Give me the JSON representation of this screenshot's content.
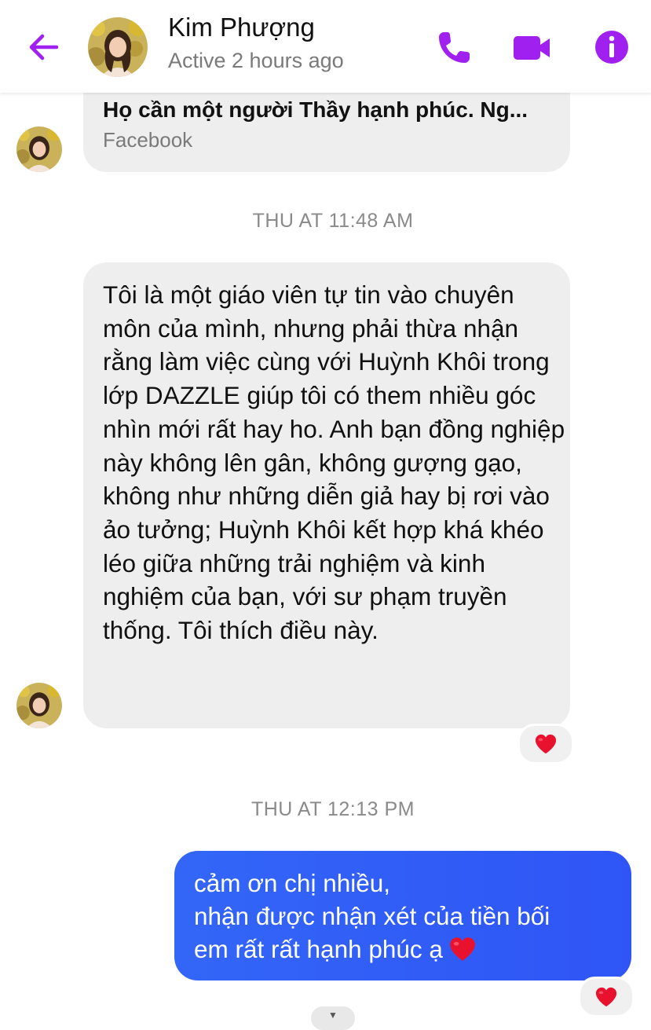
{
  "header": {
    "contact_name": "Kim Phượng",
    "status": "Active 2 hours ago",
    "accent_color": "#a020f0"
  },
  "messages": {
    "link_preview": {
      "title": "Họ cần một người Thầy hạnh phúc. Ng...",
      "source": "Facebook"
    },
    "timestamp_1": "THU AT 11:48 AM",
    "received_text": "Tôi là một giáo viên tự tin vào chuyên môn của mình, nhưng phải thừa nhận rằng làm việc cùng với Huỳnh Khôi trong lớp DAZZLE giúp tôi có them nhiều góc nhìn mới rất hay ho. Anh bạn đồng nghiệp này không lên gân, không gượng gạo, không như những diễn giả hay bị rơi vào ảo tưởng; Huỳnh Khôi kết hợp khá khéo léo giữa những trải nghiệm và kinh nghiệm của bạn, với sư phạm truyền thống. Tôi thích điều này.",
    "timestamp_2": "THU AT 12:13 PM",
    "sent_text": {
      "line1": "cảm ơn chị nhiều,",
      "line2": "nhận được nhận xét của tiền bối",
      "line3": "em rất rất hạnh phúc ạ"
    },
    "sent_bubble_color": "#3366f7",
    "reaction_icon": "red-heart-icon"
  }
}
